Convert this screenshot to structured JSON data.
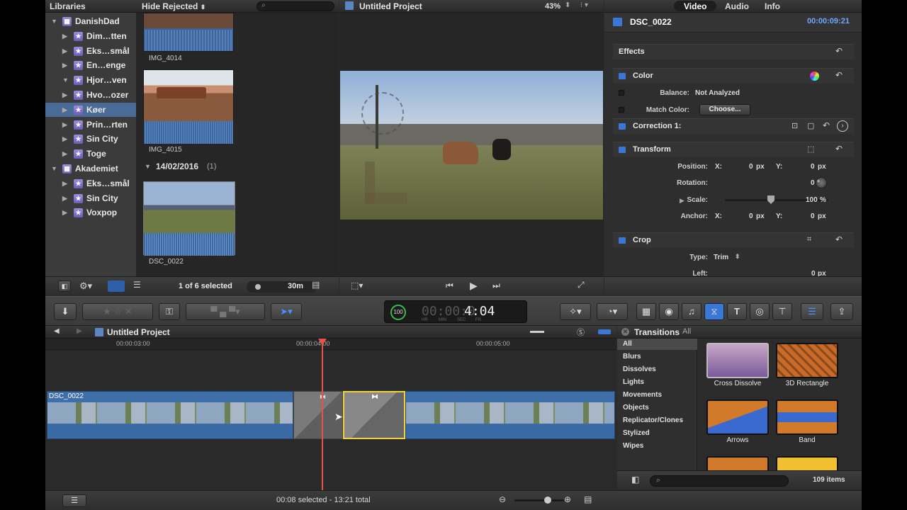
{
  "libraries": {
    "header": "Libraries",
    "items": [
      {
        "label": "DanishDad",
        "level": 0,
        "expanded": true,
        "type": "library"
      },
      {
        "label": "Dim…tten",
        "level": 1
      },
      {
        "label": "Eks…smål",
        "level": 1
      },
      {
        "label": "En…enge",
        "level": 1
      },
      {
        "label": "Hjor…ven",
        "level": 1,
        "expanded": true
      },
      {
        "label": "Hvo…ozer",
        "level": 1
      },
      {
        "label": "Køer",
        "level": 1,
        "selected": true
      },
      {
        "label": "Prin…rten",
        "level": 1
      },
      {
        "label": "Sin City",
        "level": 1
      },
      {
        "label": "Toge",
        "level": 1
      },
      {
        "label": "Akademiet",
        "level": 0,
        "expanded": true,
        "type": "library"
      },
      {
        "label": "Eks…smål",
        "level": 1
      },
      {
        "label": "Sin City",
        "level": 1
      },
      {
        "label": "Voxpop",
        "level": 1
      }
    ]
  },
  "browser": {
    "filter": "Hide Rejected",
    "clips": [
      {
        "name": "IMG_4014"
      },
      {
        "name": "IMG_4015"
      }
    ],
    "date_group": "14/02/2016",
    "date_count": "(1)",
    "clip3": "DSC_0022",
    "selection_text": "1 of 6 selected",
    "duration": "30m"
  },
  "viewer": {
    "title": "Untitled Project",
    "zoom": "43%"
  },
  "inspector": {
    "tabs": [
      "Video",
      "Audio",
      "Info"
    ],
    "clip_name": "DSC_0022",
    "timecode": "00:00:09:21",
    "sections": {
      "effects": "Effects",
      "color": "Color",
      "balance_label": "Balance:",
      "balance_value": "Not Analyzed",
      "match_label": "Match Color:",
      "match_button": "Choose...",
      "correction": "Correction 1:",
      "transform": "Transform",
      "position_label": "Position:",
      "x_label": "X:",
      "x_value": "0",
      "y_label": "Y:",
      "y_value": "0",
      "px": "px",
      "rotation_label": "Rotation:",
      "rotation_value": "0",
      "deg": "°",
      "scale_label": "Scale:",
      "scale_value": "100",
      "pct": "%",
      "anchor_label": "Anchor:",
      "crop": "Crop",
      "type_label": "Type:",
      "type_value": "Trim",
      "left_label": "Left:",
      "left_value": "0"
    }
  },
  "dashboard": {
    "timecode": "4:04",
    "timecode_dim": "00:00:0",
    "units": [
      "HR",
      "MIN",
      "SEC",
      "FR"
    ],
    "progress": "100"
  },
  "timeline": {
    "project": "Untitled Project",
    "ticks": [
      "00:00:03:00",
      "00:00:04:00",
      "00:00:05:00"
    ],
    "clip_name": "DSC_0022"
  },
  "transitions": {
    "title": "Transitions",
    "filter": "All",
    "categories": [
      "All",
      "Blurs",
      "Dissolves",
      "Lights",
      "Movements",
      "Objects",
      "Replicator/Clones",
      "Stylized",
      "Wipes"
    ],
    "items": [
      "Cross Dissolve",
      "3D Rectangle",
      "Arrows",
      "Band"
    ],
    "count": "109 items"
  },
  "status": {
    "text": "00:08 selected - 13:21 total"
  },
  "colors": {
    "accent": "#3a78d8",
    "selection": "#4a6b98",
    "playhead": "#e8504a",
    "transition_highlight": "#f2d33a",
    "timecode_blue": "#6fa8ff"
  }
}
